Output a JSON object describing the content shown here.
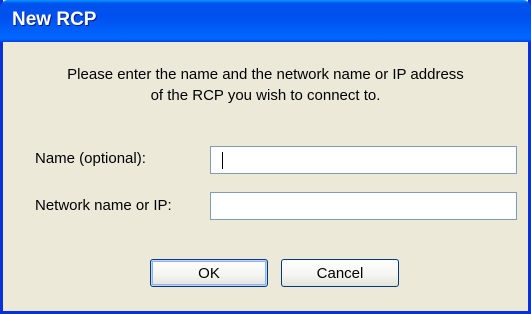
{
  "dialog": {
    "title": "New RCP",
    "message_line1": "Please enter the name and the network name or IP address",
    "message_line2": "of the RCP you wish to connect to."
  },
  "fields": {
    "name_label": "Name (optional):",
    "name_value": "",
    "network_label": "Network name or IP:",
    "network_value": ""
  },
  "buttons": {
    "ok_label": "OK",
    "cancel_label": "Cancel"
  },
  "colors": {
    "titlebar": "#0053ee",
    "window_bg": "#ece9d8",
    "input_border": "#7f9db9"
  }
}
